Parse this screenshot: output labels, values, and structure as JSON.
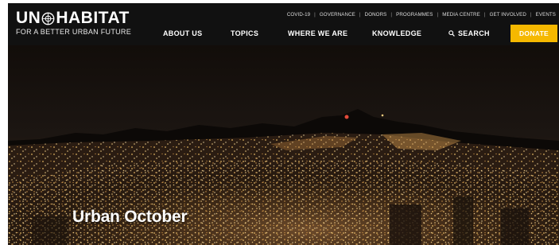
{
  "brand": {
    "logo_left": "UN",
    "logo_right": "HABITAT",
    "tagline": "FOR A BETTER URBAN FUTURE"
  },
  "utility_nav": [
    "COVID-19",
    "GOVERNANCE",
    "DONORS",
    "PROGRAMMES",
    "MEDIA CENTRE",
    "GET INVOLVED",
    "EVENTS"
  ],
  "main_nav": {
    "about": "ABOUT US",
    "topics": "TOPICS",
    "where": "WHERE WE ARE",
    "knowledge": "KNOWLEDGE",
    "search": "SEARCH",
    "donate": "DONATE"
  },
  "hero": {
    "title": "Urban October"
  },
  "colors": {
    "header_bg": "#111111",
    "donate_bg": "#f5b800",
    "city_lights": "#f3c46a"
  },
  "icons": {
    "emblem": "un-emblem-icon",
    "search": "search-icon"
  }
}
